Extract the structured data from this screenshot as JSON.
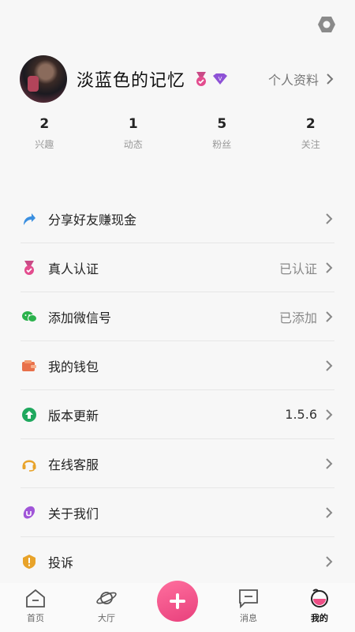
{
  "header": {
    "settings_icon": "settings-hexagon-icon"
  },
  "profile": {
    "username": "淡蓝色的记忆",
    "badges": [
      "medal-badge-icon",
      "vip-badge-icon"
    ],
    "profile_link": "个人资料"
  },
  "stats": [
    {
      "value": "2",
      "label": "兴趣"
    },
    {
      "value": "1",
      "label": "动态"
    },
    {
      "value": "5",
      "label": "粉丝"
    },
    {
      "value": "2",
      "label": "关注"
    }
  ],
  "menu": [
    {
      "icon": "share-arrow-icon",
      "label": "分享好友赚现金",
      "value": ""
    },
    {
      "icon": "verified-medal-icon",
      "label": "真人认证",
      "value": "已认证"
    },
    {
      "icon": "wechat-icon",
      "label": "添加微信号",
      "value": "已添加"
    },
    {
      "icon": "wallet-icon",
      "label": "我的钱包",
      "value": ""
    },
    {
      "icon": "update-arrow-icon",
      "label": "版本更新",
      "value": "1.5.6"
    },
    {
      "icon": "headset-icon",
      "label": "在线客服",
      "value": ""
    },
    {
      "icon": "about-us-icon",
      "label": "关于我们",
      "value": ""
    },
    {
      "icon": "complaint-warning-icon",
      "label": "投诉",
      "value": ""
    }
  ],
  "tabbar": {
    "tabs": [
      {
        "icon": "home-icon",
        "label": "首页"
      },
      {
        "icon": "planet-icon",
        "label": "大厅"
      },
      {
        "icon": "add-icon",
        "label": ""
      },
      {
        "icon": "message-icon",
        "label": "消息"
      },
      {
        "icon": "profile-icon",
        "label": "我的"
      }
    ],
    "active": "我的"
  },
  "colors": {
    "accent_pink": "#ee4f86",
    "background": "#f7f7f7"
  }
}
